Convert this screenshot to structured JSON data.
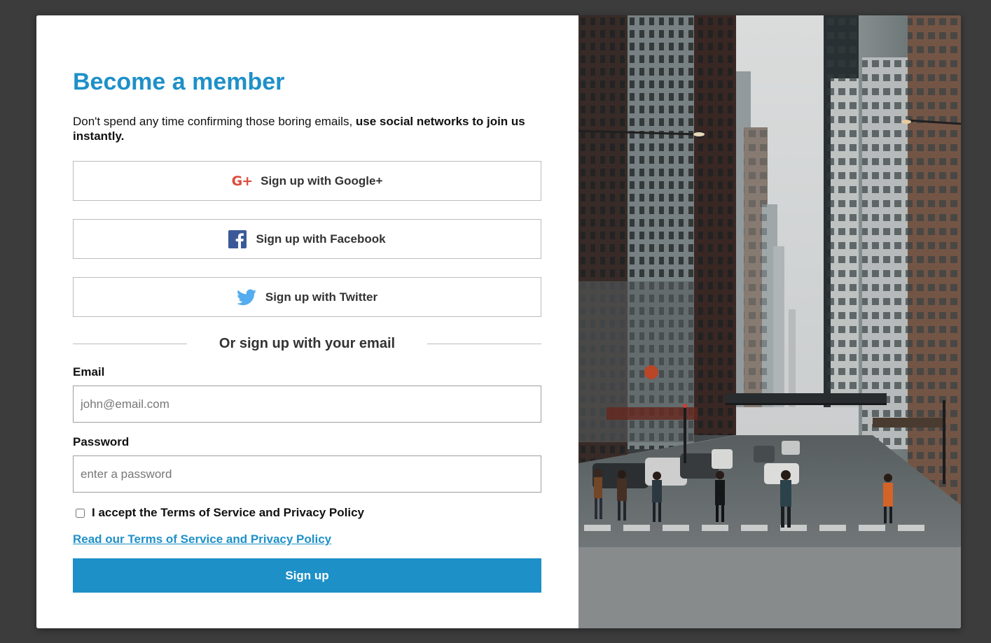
{
  "form": {
    "title": "Become a member",
    "intro_plain": "Don't spend any time confirming those boring emails, ",
    "intro_bold": "use social networks to join us instantly.",
    "social": {
      "google_label": "Sign up with Google+",
      "facebook_label": "Sign up with Facebook",
      "twitter_label": "Sign up with Twitter"
    },
    "divider_text": "Or sign up with your email",
    "email": {
      "label": "Email",
      "placeholder": "john@email.com",
      "value": ""
    },
    "password": {
      "label": "Password",
      "placeholder": "enter a password",
      "value": ""
    },
    "terms_checkbox_label": "I accept the Terms of Service and Privacy Policy",
    "terms_checked": false,
    "terms_link": "Read our Terms of Service and Privacy Policy",
    "submit_label": "Sign up"
  },
  "icons": {
    "google": "google-plus-icon",
    "facebook": "facebook-icon",
    "twitter": "twitter-icon"
  },
  "colors": {
    "accent": "#1e90c8",
    "google": "#dd4b39",
    "facebook": "#3b5998",
    "twitter": "#55acee",
    "backdrop": "#3c3c3c"
  }
}
